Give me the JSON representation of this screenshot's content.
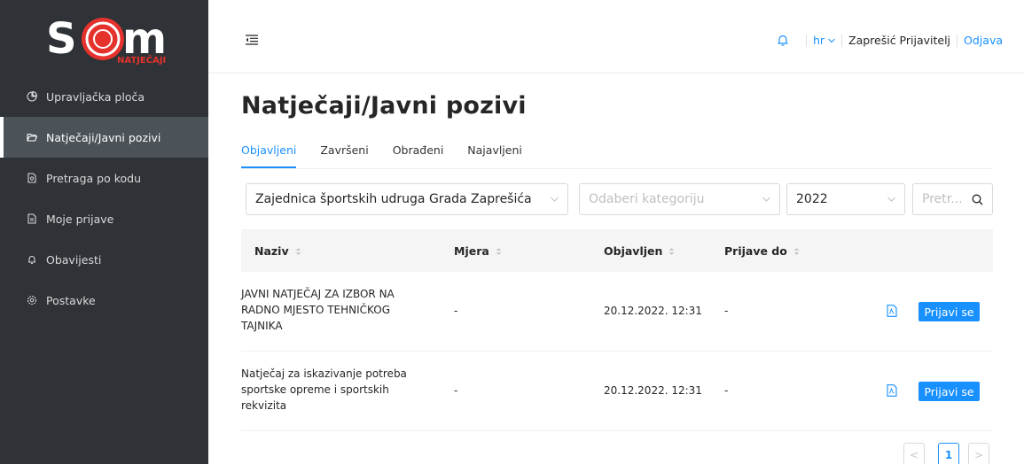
{
  "brand": {
    "logo_letters": "S  M",
    "logo_tagline": "NATJEČAJI",
    "colors": {
      "logo_red": "#e5322d",
      "sidebar_bg": "#2f3236",
      "accent": "#1890ff"
    }
  },
  "sidebar": {
    "items": [
      {
        "label": "Upravljačka ploča",
        "icon": "pie-chart-icon",
        "active": false
      },
      {
        "label": "Natječaji/Javni pozivi",
        "icon": "folder-open-icon",
        "active": true
      },
      {
        "label": "Pretraga po kodu",
        "icon": "file-search-icon",
        "active": false
      },
      {
        "label": "Moje prijave",
        "icon": "file-text-icon",
        "active": false
      },
      {
        "label": "Obavijesti",
        "icon": "bell-icon",
        "active": false
      },
      {
        "label": "Postavke",
        "icon": "gear-icon",
        "active": false
      }
    ]
  },
  "header": {
    "language": "hr",
    "user": "Zaprešić Prijavitelj",
    "logout": "Odjava"
  },
  "main": {
    "title": "Natječaji/Javni pozivi",
    "tabs": [
      {
        "label": "Objavljeni",
        "active": true
      },
      {
        "label": "Završeni",
        "active": false
      },
      {
        "label": "Obrađeni",
        "active": false
      },
      {
        "label": "Najavljeni",
        "active": false
      }
    ],
    "filters": {
      "organization": "Zajednica športskih udruga Grada Zaprešića",
      "category_placeholder": "Odaberi kategoriju",
      "year": "2022",
      "search_placeholder": "Pretr..."
    },
    "table": {
      "columns": [
        "Naziv",
        "Mjera",
        "Objavljen",
        "Prijave do"
      ],
      "rows": [
        {
          "naziv": [
            "JAVNI NATJEČAJ ZA IZBOR NA",
            "RADNO MJESTO TEHNIČKOG",
            "TAJNIKA"
          ],
          "mjera": "-",
          "objavljen": "20.12.2022. 12:31",
          "prijave_do": "-",
          "action": "Prijavi se"
        },
        {
          "naziv": [
            "Natječaj za iskazivanje potreba",
            "sportske opreme i sportskih",
            "rekvizita"
          ],
          "mjera": "-",
          "objavljen": "20.12.2022. 12:31",
          "prijave_do": "-",
          "action": "Prijavi se"
        }
      ]
    },
    "pagination": {
      "prev": "<",
      "current": "1",
      "next": ">"
    }
  }
}
